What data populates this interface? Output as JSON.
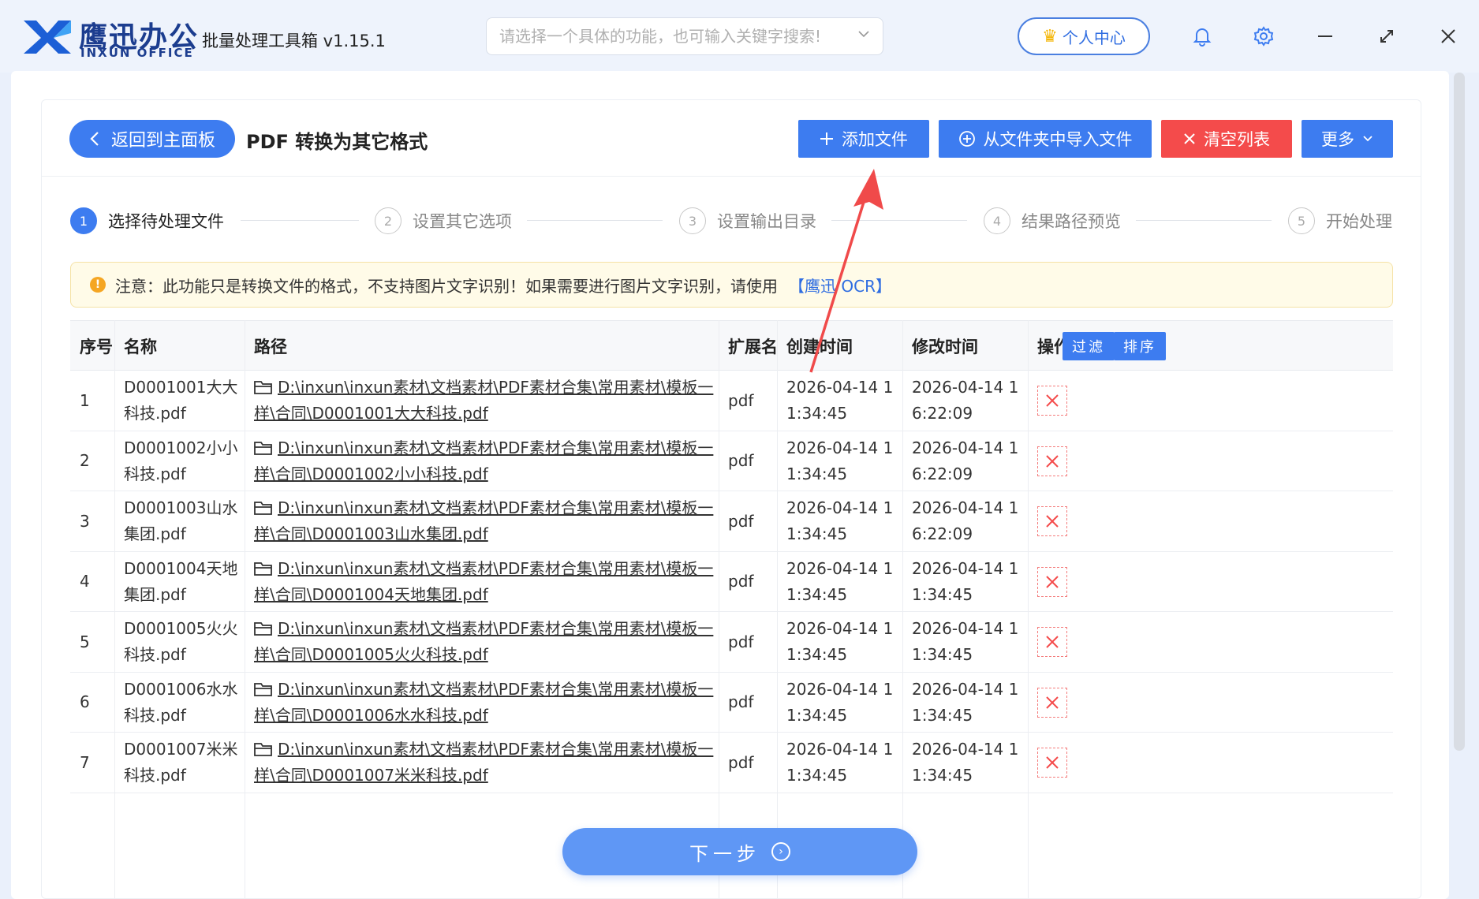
{
  "titlebar": {
    "brand_cn": "鹰迅办公",
    "brand_en": "INXUN OFFICE",
    "app_title": "批量处理工具箱 v1.15.1",
    "search_placeholder": "请选择一个具体的功能，也可输入关键字搜索!",
    "user_center": "个人中心"
  },
  "toolbar": {
    "back_label": "返回到主面板",
    "page_title": "PDF 转换为其它格式",
    "add_file": "添加文件",
    "import_folder": "从文件夹中导入文件",
    "clear_list": "清空列表",
    "more": "更多"
  },
  "steps": [
    {
      "num": "1",
      "label": "选择待处理文件"
    },
    {
      "num": "2",
      "label": "设置其它选项"
    },
    {
      "num": "3",
      "label": "设置输出目录"
    },
    {
      "num": "4",
      "label": "结果路径预览"
    },
    {
      "num": "5",
      "label": "开始处理"
    }
  ],
  "notice": {
    "text": "注意：此功能只是转换文件的格式，不支持图片文字识别！如果需要进行图片文字识别，请使用",
    "link": "【鹰迅 OCR】"
  },
  "table": {
    "headers": {
      "index": "序号",
      "name": "名称",
      "path": "路径",
      "ext": "扩展名",
      "created": "创建时间",
      "modified": "修改时间",
      "action": "操作",
      "filter": "过滤",
      "sort": "排序"
    },
    "rows": [
      {
        "index": "1",
        "name": "D0001001大大科技.pdf",
        "path": "D:\\inxun\\inxun素材\\文档素材\\PDF素材合集\\常用素材\\模板一样\\合同\\D0001001大大科技.pdf",
        "ext": "pdf",
        "created": "2026-04-14 11:34:45",
        "modified": "2026-04-14 16:22:09"
      },
      {
        "index": "2",
        "name": "D0001002小小科技.pdf",
        "path": "D:\\inxun\\inxun素材\\文档素材\\PDF素材合集\\常用素材\\模板一样\\合同\\D0001002小小科技.pdf",
        "ext": "pdf",
        "created": "2026-04-14 11:34:45",
        "modified": "2026-04-14 16:22:09"
      },
      {
        "index": "3",
        "name": "D0001003山水集团.pdf",
        "path": "D:\\inxun\\inxun素材\\文档素材\\PDF素材合集\\常用素材\\模板一样\\合同\\D0001003山水集团.pdf",
        "ext": "pdf",
        "created": "2026-04-14 11:34:45",
        "modified": "2026-04-14 16:22:09"
      },
      {
        "index": "4",
        "name": "D0001004天地集团.pdf",
        "path": "D:\\inxun\\inxun素材\\文档素材\\PDF素材合集\\常用素材\\模板一样\\合同\\D0001004天地集团.pdf",
        "ext": "pdf",
        "created": "2026-04-14 11:34:45",
        "modified": "2026-04-14 11:34:45"
      },
      {
        "index": "5",
        "name": "D0001005火火科技.pdf",
        "path": "D:\\inxun\\inxun素材\\文档素材\\PDF素材合集\\常用素材\\模板一样\\合同\\D0001005火火科技.pdf",
        "ext": "pdf",
        "created": "2026-04-14 11:34:45",
        "modified": "2026-04-14 11:34:45"
      },
      {
        "index": "6",
        "name": "D0001006水水科技.pdf",
        "path": "D:\\inxun\\inxun素材\\文档素材\\PDF素材合集\\常用素材\\模板一样\\合同\\D0001006水水科技.pdf",
        "ext": "pdf",
        "created": "2026-04-14 11:34:45",
        "modified": "2026-04-14 11:34:45"
      },
      {
        "index": "7",
        "name": "D0001007米米科技.pdf",
        "path": "D:\\inxun\\inxun素材\\文档素材\\PDF素材合集\\常用素材\\模板一样\\合同\\D0001007米米科技.pdf",
        "ext": "pdf",
        "created": "2026-04-14 11:34:45",
        "modified": "2026-04-14 11:34:45"
      }
    ]
  },
  "next_button": "下一步",
  "colors": {
    "accent": "#3d7cf0",
    "danger": "#f44b4b",
    "notice_bg": "#fffbe8",
    "annotation_arrow": "#f04a4a"
  },
  "icons": [
    "brand-x-icon",
    "crown-icon",
    "bell-icon",
    "gear-icon",
    "minimize-icon",
    "restore-icon",
    "close-icon",
    "chevron-down-icon",
    "chevron-left-icon",
    "plus-icon",
    "plus-circle-icon",
    "x-icon",
    "warning-icon",
    "folder-icon",
    "delete-icon",
    "arrow-right-circle-icon"
  ]
}
